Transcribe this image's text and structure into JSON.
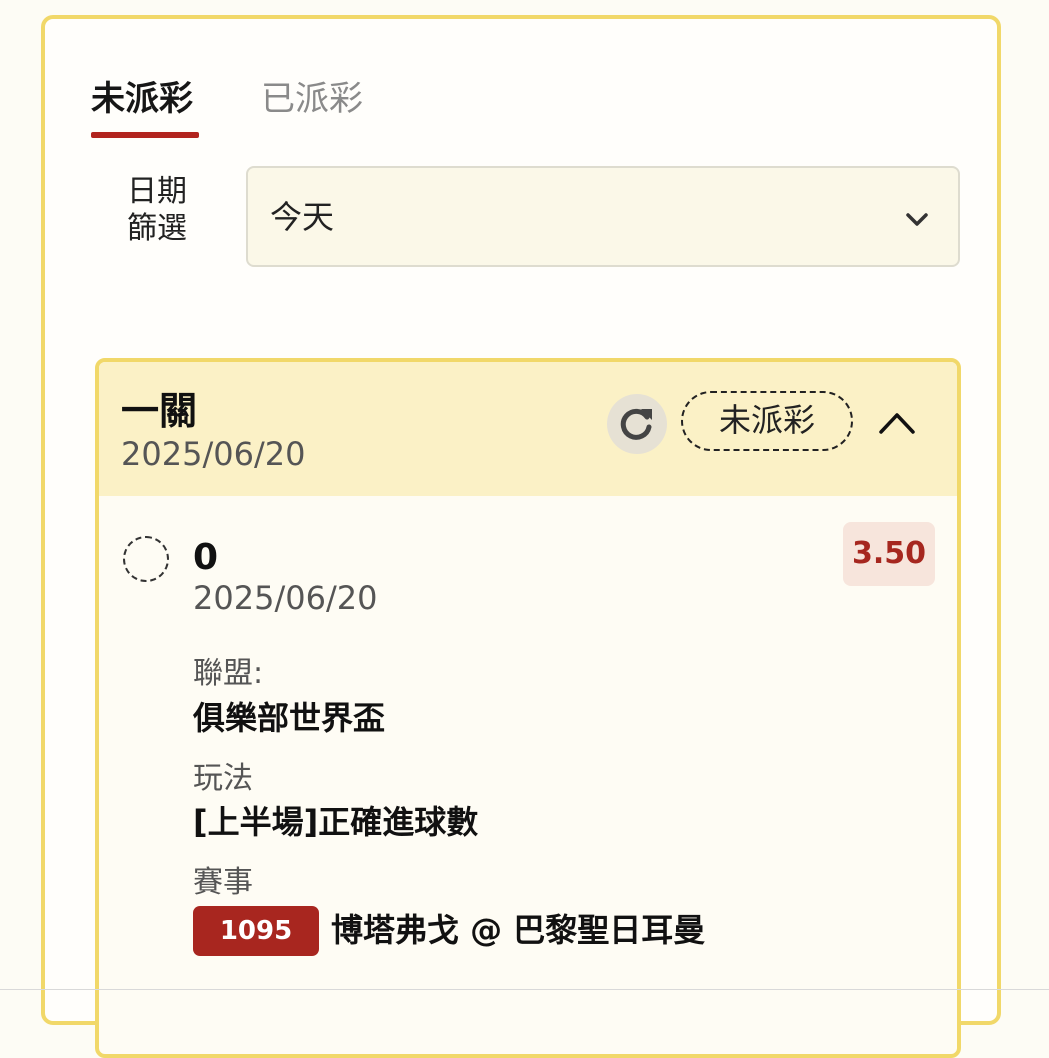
{
  "tabs": {
    "unsettled": "未派彩",
    "settled": "已派彩"
  },
  "filter": {
    "label_line1": "日期",
    "label_line2": "篩選",
    "value": "今天"
  },
  "bet": {
    "type": "一關",
    "date": "2025/06/20",
    "status": "未派彩",
    "selection": {
      "name": "0",
      "date": "2025/06/20",
      "odds": "3.50",
      "league_label": "聯盟:",
      "league": "俱樂部世界盃",
      "market_label": "玩法",
      "market": "[上半場]正確進球數",
      "event_label": "賽事",
      "match_id": "1095",
      "match": "博塔弗戈 @ 巴黎聖日耳曼"
    }
  },
  "colors": {
    "accent_red": "#b2241e",
    "border_yellow": "#f1d869",
    "header_yellow": "#fbf1c6"
  },
  "icons": {
    "refresh": "refresh-icon",
    "dropdown": "chevron-down-icon",
    "collapse": "chevron-up-icon"
  }
}
